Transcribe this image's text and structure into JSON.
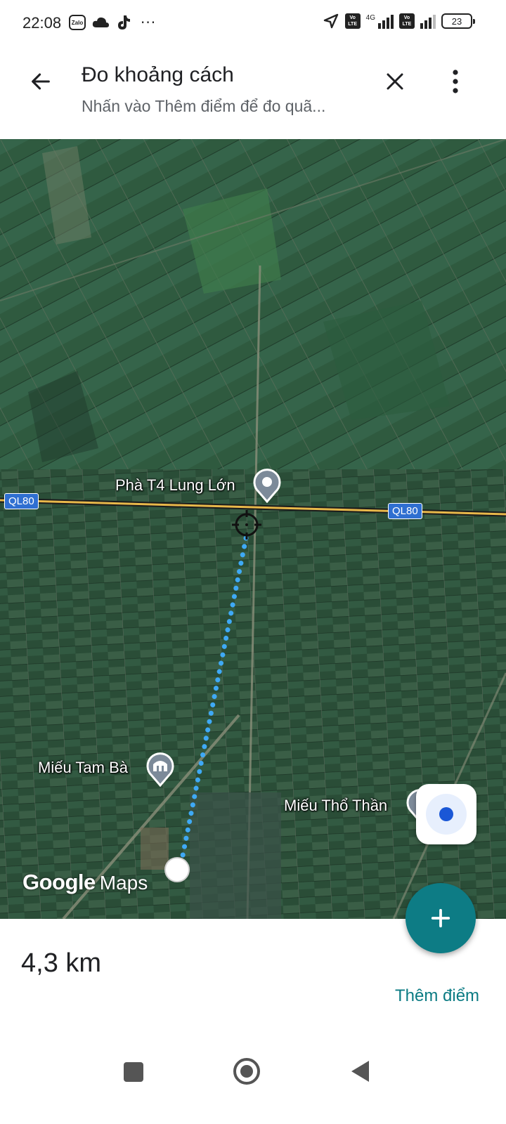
{
  "status_bar": {
    "time": "22:08",
    "left_icons": [
      "zalo-icon",
      "cloud-icon",
      "tiktok-icon"
    ],
    "zalo_text": "Zalo",
    "more_indicator": "···",
    "network_type": "4G",
    "volte_label": "Vo LTE",
    "battery": "23"
  },
  "app_bar": {
    "title": "Đo khoảng cách",
    "subtitle": "Nhấn vào Thêm điểm để đo quã..."
  },
  "map": {
    "places": {
      "ferry": "Phà T4 Lung Lớn",
      "temple_tam_ba": "Miếu Tam Bà",
      "temple_tho_than": "Miếu Thổ Thần"
    },
    "road_labels": [
      "QL80",
      "QL80"
    ],
    "logo": {
      "google": "Google",
      "maps": "Maps"
    },
    "colors": {
      "measure_line": "#3fa9f5",
      "road": "#e8b84a"
    }
  },
  "bottom_panel": {
    "distance": "4,3 km",
    "add_point_label": "Thêm điểm"
  },
  "colors": {
    "accent": "#0d7c85",
    "location_dot": "#1a57d6"
  }
}
